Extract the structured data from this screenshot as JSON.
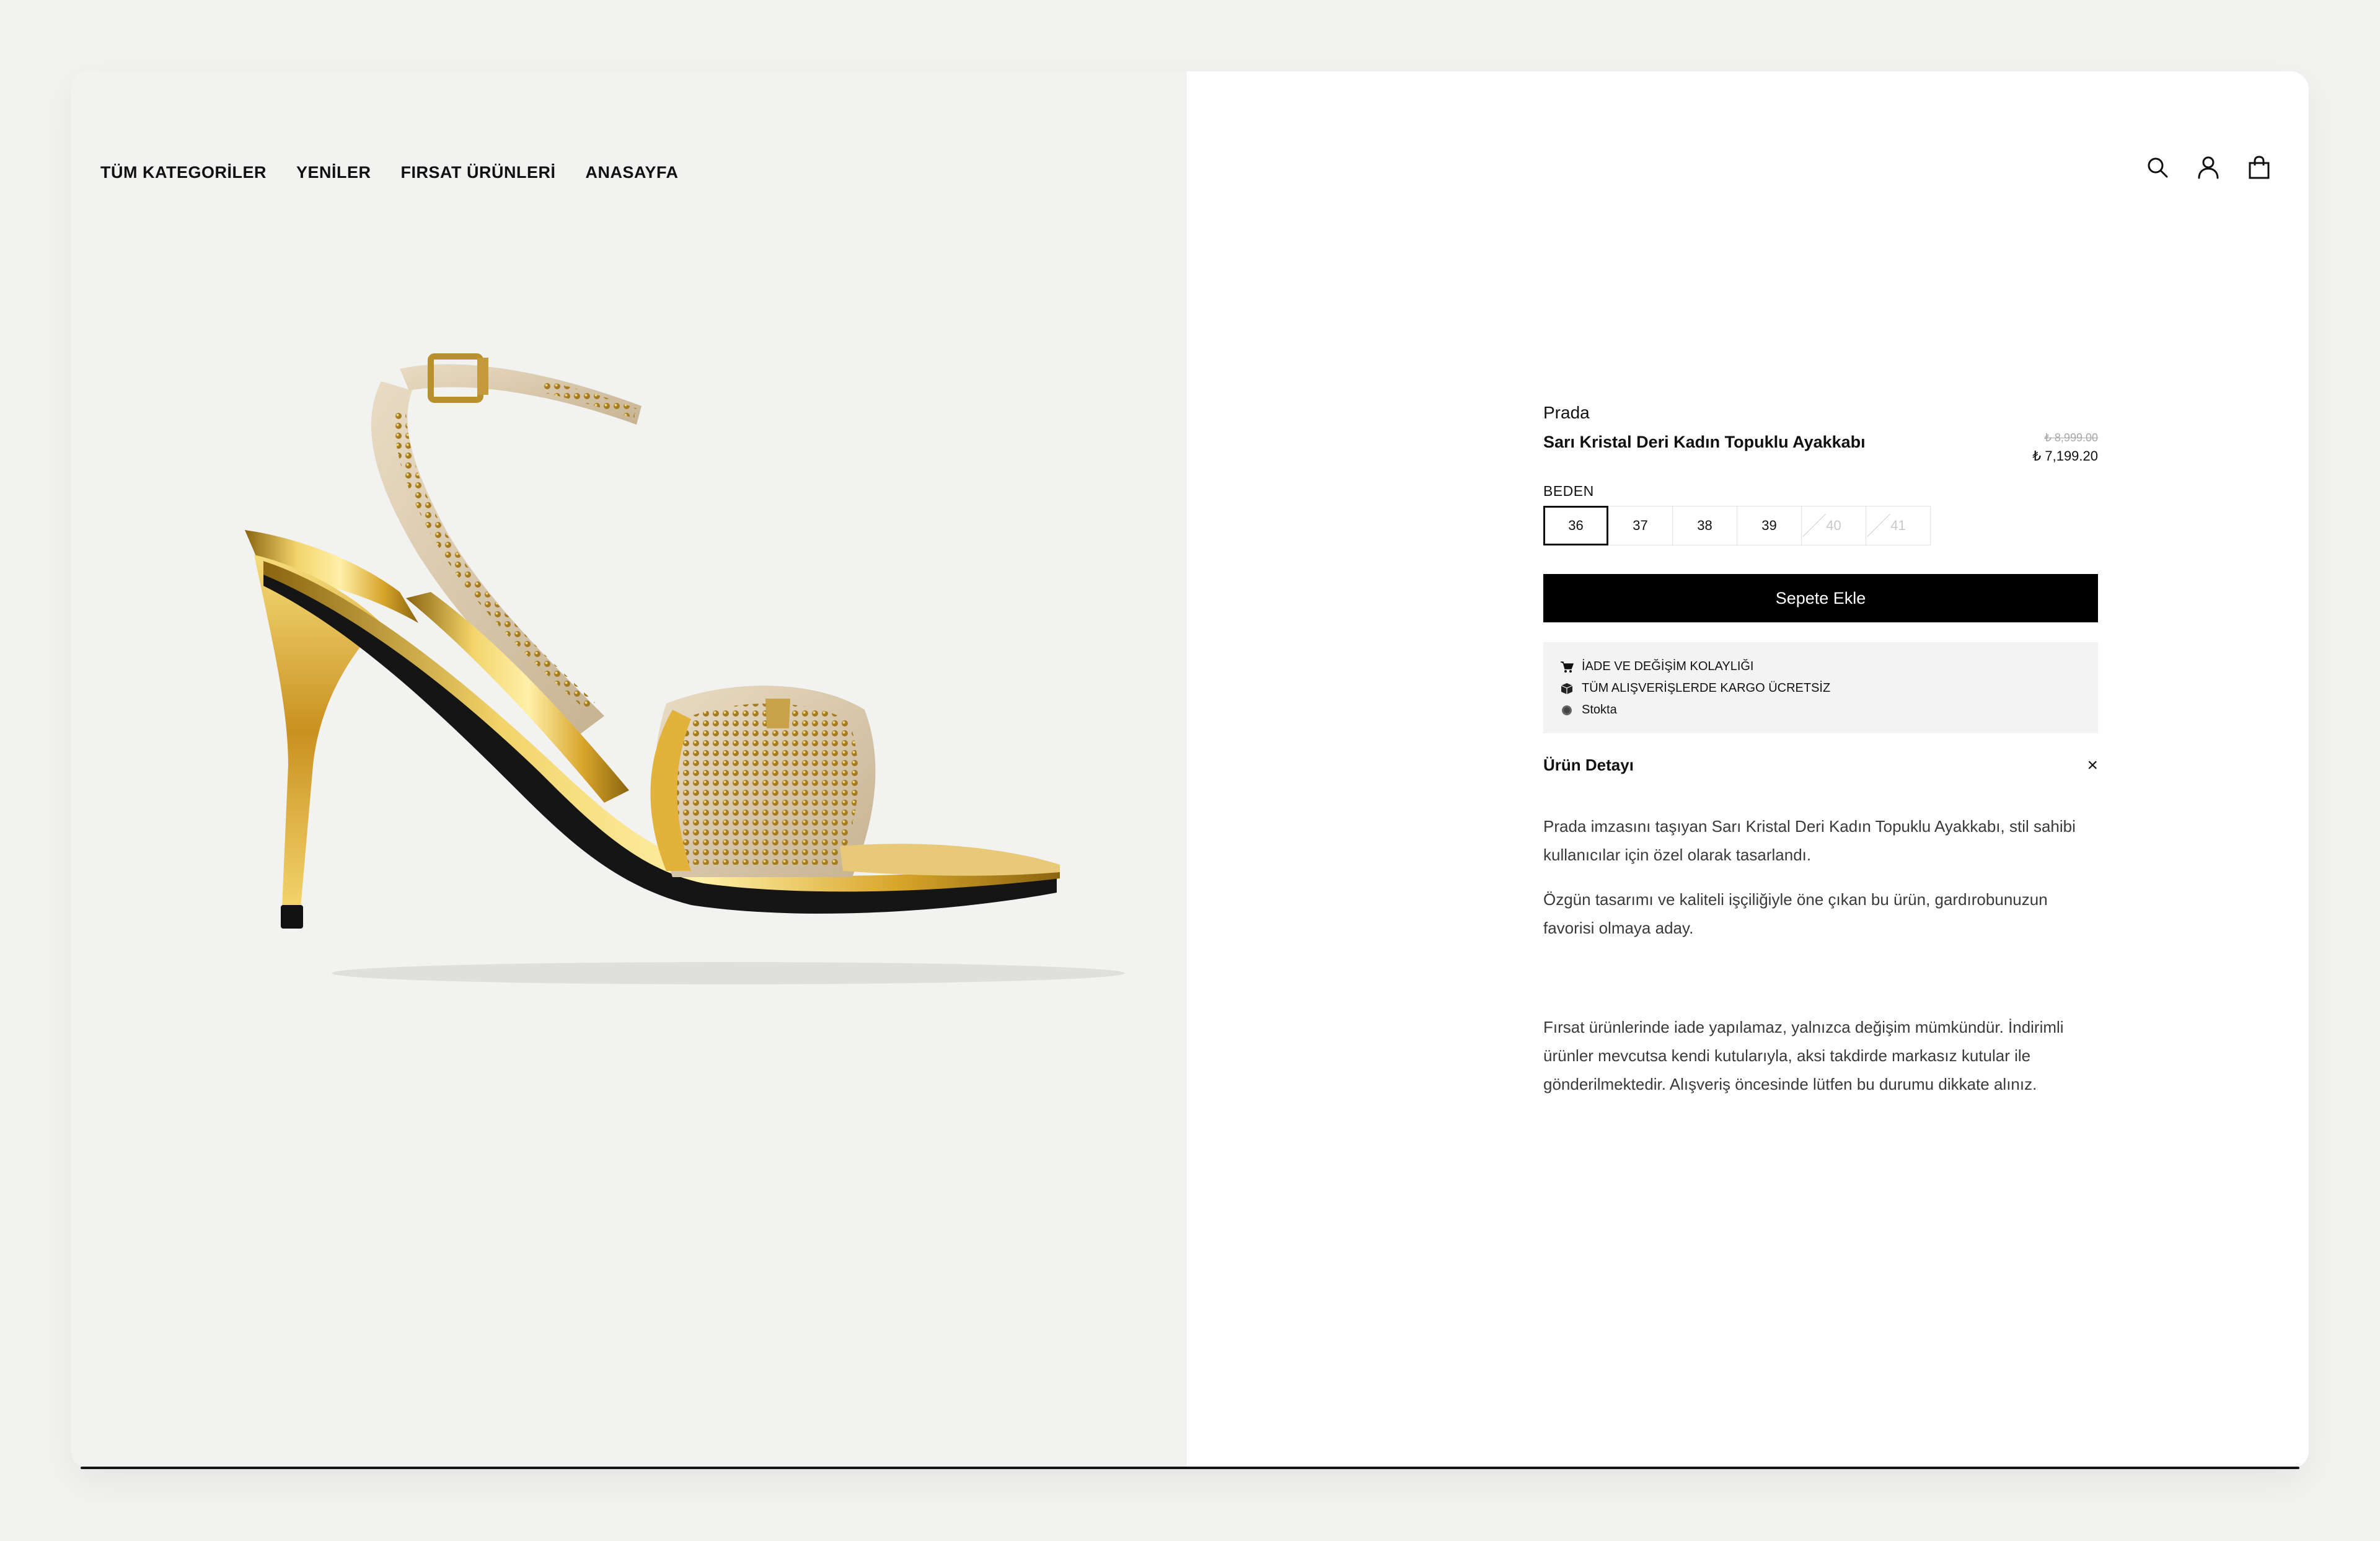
{
  "nav": {
    "items": [
      {
        "label": "TÜM KATEGORİLER"
      },
      {
        "label": "YENİLER"
      },
      {
        "label": "FIRSAT ÜRÜNLERİ"
      },
      {
        "label": "ANASAYFA"
      }
    ]
  },
  "header": {
    "icons": [
      "search-icon",
      "user-icon",
      "bag-icon"
    ]
  },
  "product": {
    "brand": "Prada",
    "title": "Sarı Kristal Deri Kadın Topuklu Ayakkabı",
    "old_price": "₺ 8,999.00",
    "new_price": "₺ 7,199.20",
    "size_label": "BEDEN",
    "sizes": [
      {
        "label": "36",
        "state": "selected"
      },
      {
        "label": "37",
        "state": "available"
      },
      {
        "label": "38",
        "state": "available"
      },
      {
        "label": "39",
        "state": "available"
      },
      {
        "label": "40",
        "state": "disabled"
      },
      {
        "label": "41",
        "state": "disabled"
      }
    ],
    "add_to_cart": "Sepete Ekle"
  },
  "info": {
    "rows": [
      {
        "icon": "cart-icon",
        "text": "İADE VE DEĞİŞİM KOLAYLIĞI"
      },
      {
        "icon": "box-icon",
        "text": "TÜM ALIŞVERİŞLERDE KARGO ÜCRETSİZ"
      },
      {
        "icon": "status-dot-icon",
        "text": "Stokta"
      }
    ]
  },
  "detail": {
    "title": "Ürün Detayı",
    "close": "×",
    "paragraphs": [
      "Prada imzasını taşıyan Sarı Kristal Deri Kadın Topuklu Ayakkabı, stil sahibi kullanıcılar için özel olarak tasarlandı.",
      "Özgün tasarımı ve kaliteli işçiliğiyle öne çıkan bu ürün, gardırobunuzun favorisi olmaya aday.",
      "Fırsat ürünlerinde iade yapılamaz, yalnızca değişim mümkündür. İndirimli ürünler mevcutsa kendi kutularıyla, aksi takdirde markasız kutular ile gönderilmektedir. Alışveriş öncesinde lütfen bu durumu dikkate alınız."
    ]
  },
  "colors": {
    "accent": "#000000",
    "info_bg": "#f3f3f3",
    "image_bg": "#f2f2f1"
  }
}
